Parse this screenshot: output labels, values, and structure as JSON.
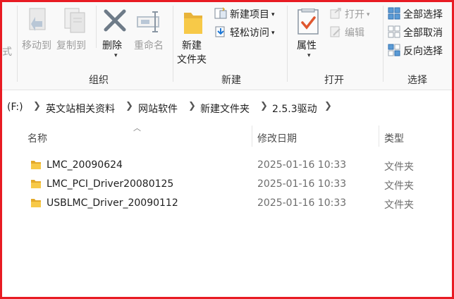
{
  "ribbon": {
    "clipboard_tail": "式",
    "organize": {
      "label": "组织",
      "move_to": "移动到",
      "copy_to": "复制到",
      "delete": "删除",
      "rename": "重命名"
    },
    "new": {
      "label": "新建",
      "new_folder_line1": "新建",
      "new_folder_line2": "文件夹",
      "new_item": "新建项目",
      "easy_access": "轻松访问"
    },
    "open": {
      "label": "打开",
      "properties": "属性",
      "open": "打开",
      "edit": "编辑"
    },
    "select": {
      "label": "选择",
      "select_all": "全部选择",
      "select_none": "全部取消",
      "invert": "反向选择"
    }
  },
  "address": {
    "drive": "(F:)",
    "crumbs": [
      "英文站相关资料",
      "网站软件",
      "新建文件夹",
      "2.5.3驱动"
    ]
  },
  "columns": {
    "name": "名称",
    "date": "修改日期",
    "type": "类型"
  },
  "files": [
    {
      "name": "LMC_20090624",
      "date": "2025-01-16 10:33",
      "type": "文件夹"
    },
    {
      "name": "LMC_PCI_Driver20080125",
      "date": "2025-01-16 10:33",
      "type": "文件夹"
    },
    {
      "name": "USBLMC_Driver_20090112",
      "date": "2025-01-16 10:33",
      "type": "文件夹"
    }
  ],
  "colors": {
    "highlight_border": "#e81b23",
    "folder": "#f7c948",
    "accent": "#1e78d6"
  }
}
